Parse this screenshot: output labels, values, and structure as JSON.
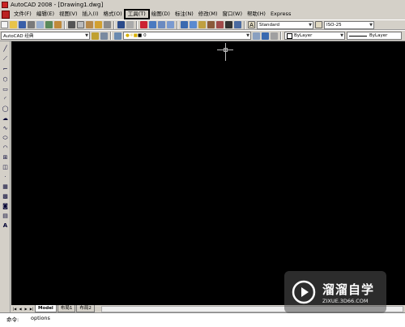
{
  "window": {
    "title": "AutoCAD 2008 - [Drawing1.dwg]"
  },
  "menu": {
    "items": [
      "文件(F)",
      "编辑(E)",
      "视图(V)",
      "插入(I)",
      "格式(O)",
      "工具(T)",
      "绘图(D)",
      "标注(N)",
      "修改(M)",
      "窗口(W)",
      "帮助(H)",
      "Express"
    ],
    "highlighted_index": 5
  },
  "toolbar1": {
    "text_style": "Standard",
    "dim_style": "ISO-25"
  },
  "toolbar2": {
    "workspace": "AutoCAD 经典",
    "layer": "0",
    "color": "ByLayer",
    "linetype": "ByLayer"
  },
  "layout_tabs": {
    "nav": [
      "|◀",
      "◀",
      "▶",
      "▶|"
    ],
    "tabs": [
      "Model",
      "布局1",
      "布局2"
    ],
    "active": "Model"
  },
  "command": {
    "prompt": "命令:",
    "value": "options"
  },
  "watermark": {
    "title": "溜溜自学",
    "subtitle": "ZIXUE.3D66.COM"
  },
  "colors": {
    "canvas": "#000000",
    "chrome": "#d4d0c8",
    "highlight_border": "#000000"
  }
}
